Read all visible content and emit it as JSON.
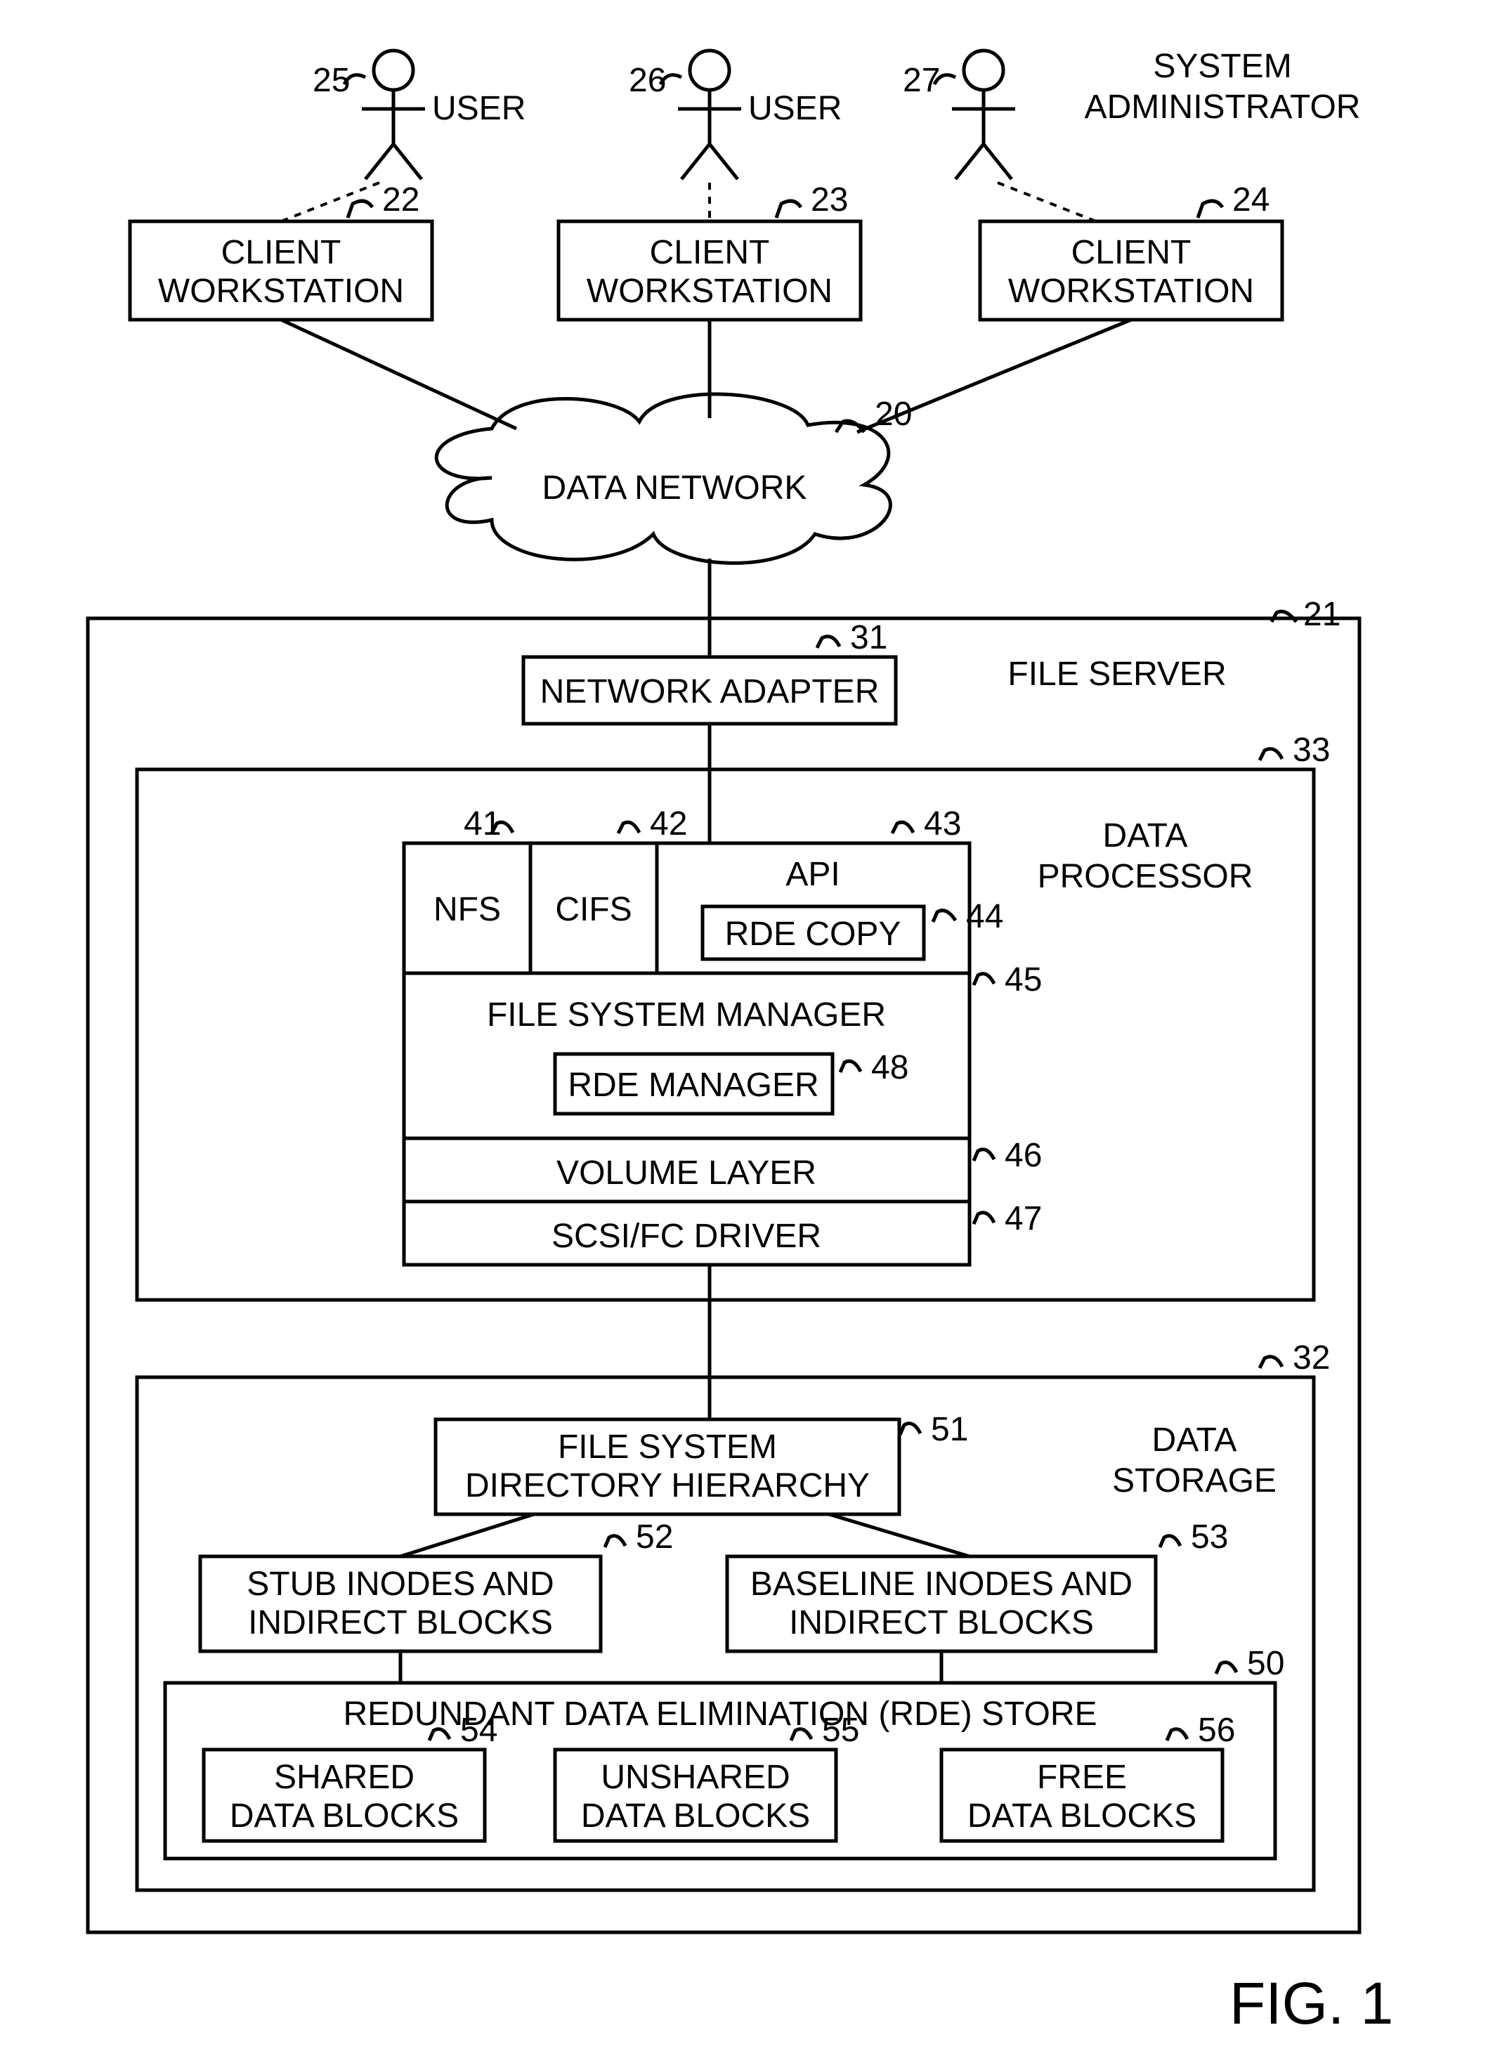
{
  "actors": [
    {
      "num": "25",
      "label": "USER"
    },
    {
      "num": "26",
      "label": "USER"
    },
    {
      "num": "27",
      "label": "SYSTEM",
      "label2": "ADMINISTRATOR"
    }
  ],
  "workstations": [
    {
      "num": "22",
      "label1": "CLIENT",
      "label2": "WORKSTATION"
    },
    {
      "num": "23",
      "label1": "CLIENT",
      "label2": "WORKSTATION"
    },
    {
      "num": "24",
      "label1": "CLIENT",
      "label2": "WORKSTATION"
    }
  ],
  "cloud": {
    "num": "20",
    "label": "DATA NETWORK"
  },
  "file_server": {
    "num": "21",
    "label": "FILE SERVER"
  },
  "network_adapter": {
    "num": "31",
    "label": "NETWORK ADAPTER"
  },
  "data_processor": {
    "num": "33",
    "label1": "DATA",
    "label2": "PROCESSOR"
  },
  "nfs": {
    "num": "41",
    "label": "NFS"
  },
  "cifs": {
    "num": "42",
    "label": "CIFS"
  },
  "api": {
    "num": "43",
    "label": "API"
  },
  "rde_copy": {
    "num": "44",
    "label": "RDE COPY"
  },
  "fsm": {
    "num": "45",
    "label": "FILE SYSTEM MANAGER"
  },
  "rde_mgr": {
    "num": "48",
    "label": "RDE MANAGER"
  },
  "volume": {
    "num": "46",
    "label": "VOLUME LAYER"
  },
  "scsi": {
    "num": "47",
    "label": "SCSI/FC DRIVER"
  },
  "data_storage": {
    "num": "32",
    "label1": "DATA",
    "label2": "STORAGE"
  },
  "fs_dir": {
    "num": "51",
    "label1": "FILE SYSTEM",
    "label2": "DIRECTORY HIERARCHY"
  },
  "stub": {
    "num": "52",
    "label1": "STUB INODES AND",
    "label2": "INDIRECT BLOCKS"
  },
  "baseline": {
    "num": "53",
    "label1": "BASELINE  INODES AND",
    "label2": "INDIRECT BLOCKS"
  },
  "rde_store": {
    "num": "50",
    "label": "REDUNDANT DATA ELIMINATION (RDE)  STORE"
  },
  "shared": {
    "num": "54",
    "label1": "SHARED",
    "label2": "DATA BLOCKS"
  },
  "unshared": {
    "num": "55",
    "label1": "UNSHARED",
    "label2": "DATA BLOCKS"
  },
  "free": {
    "num": "56",
    "label1": "FREE",
    "label2": "DATA BLOCKS"
  },
  "figure": "FIG. 1"
}
